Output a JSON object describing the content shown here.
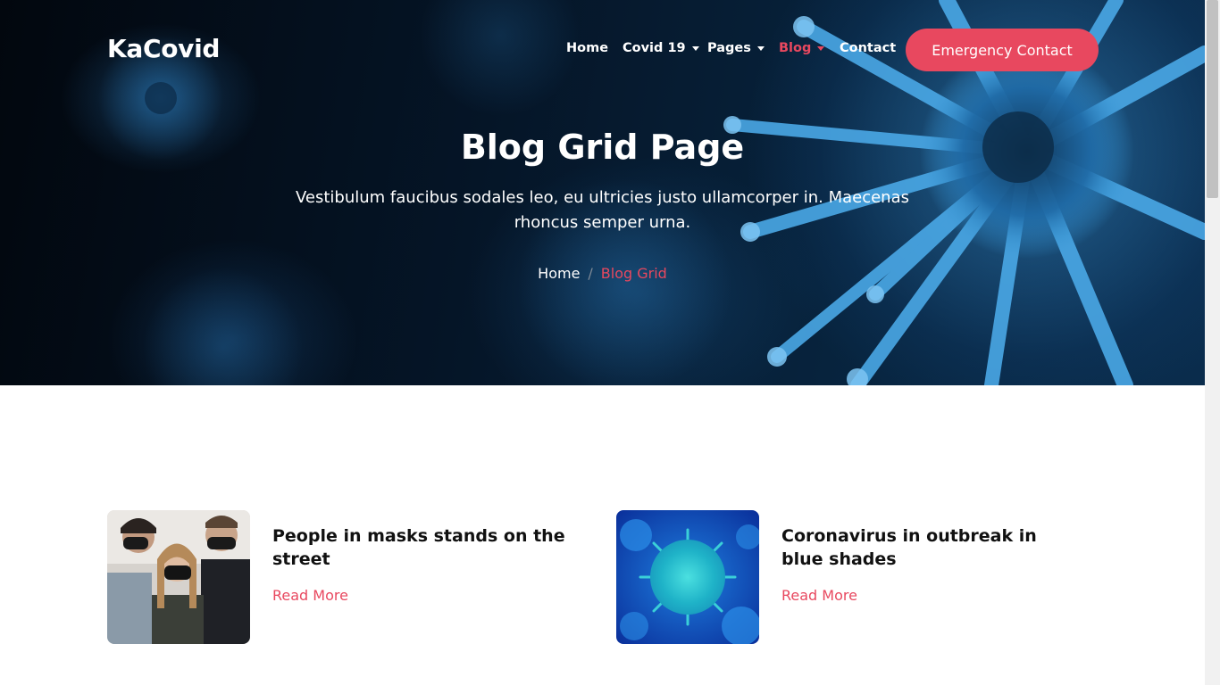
{
  "brand": {
    "logo": "KaCovid"
  },
  "nav": {
    "items": [
      {
        "label": "Home",
        "dropdown": false,
        "active": false
      },
      {
        "label": "Covid 19",
        "dropdown": true,
        "active": false
      },
      {
        "label": "Pages",
        "dropdown": true,
        "active": false
      },
      {
        "label": "Blog",
        "dropdown": true,
        "active": true
      },
      {
        "label": "Contact",
        "dropdown": false,
        "active": false
      }
    ],
    "cta_label": "Emergency Contact"
  },
  "hero": {
    "title": "Blog Grid Page",
    "subtitle": "Vestibulum faucibus sodales leo, eu ultricies justo ullamcorper in. Maecenas rhoncus semper urna.",
    "breadcrumb": {
      "home": "Home",
      "separator": "/",
      "current": "Blog Grid"
    }
  },
  "posts": [
    {
      "title": "People in masks stands on the street",
      "read_more": "Read More",
      "image": "people-in-masks-photo"
    },
    {
      "title": "Coronavirus in outbreak in blue shades",
      "read_more": "Read More",
      "image": "blue-virus-photo"
    }
  ],
  "colors": {
    "accent": "#e8485f",
    "hero_dark": "#051527",
    "virus_blue": "#3a9ad9"
  }
}
